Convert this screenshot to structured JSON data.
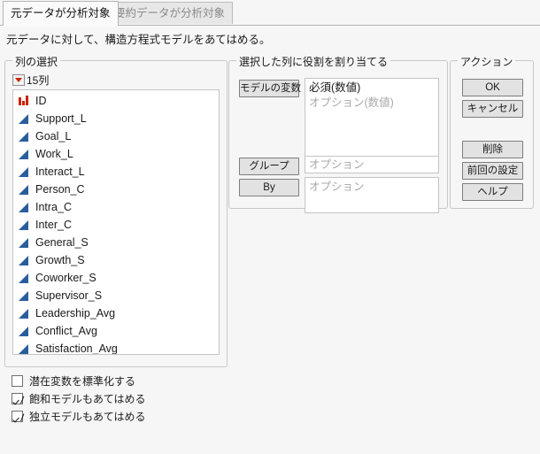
{
  "tabs": [
    {
      "label": "元データが分析対象",
      "active": true
    },
    {
      "label": "要約データが分析対象",
      "active": false
    }
  ],
  "description": "元データに対して、構造方程式モデルをあてはめる。",
  "columns_panel": {
    "title": "列の選択",
    "count_label": "15列",
    "dropdown_icon": "red-triangle-icon",
    "items": [
      {
        "label": "ID",
        "icon": "nominal-bars-icon"
      },
      {
        "label": "Support_L",
        "icon": "continuous-triangle-icon"
      },
      {
        "label": "Goal_L",
        "icon": "continuous-triangle-icon"
      },
      {
        "label": "Work_L",
        "icon": "continuous-triangle-icon"
      },
      {
        "label": "Interact_L",
        "icon": "continuous-triangle-icon"
      },
      {
        "label": "Person_C",
        "icon": "continuous-triangle-icon"
      },
      {
        "label": "Intra_C",
        "icon": "continuous-triangle-icon"
      },
      {
        "label": "Inter_C",
        "icon": "continuous-triangle-icon"
      },
      {
        "label": "General_S",
        "icon": "continuous-triangle-icon"
      },
      {
        "label": "Growth_S",
        "icon": "continuous-triangle-icon"
      },
      {
        "label": "Coworker_S",
        "icon": "continuous-triangle-icon"
      },
      {
        "label": "Supervisor_S",
        "icon": "continuous-triangle-icon"
      },
      {
        "label": "Leadership_Avg",
        "icon": "continuous-triangle-icon"
      },
      {
        "label": "Conflict_Avg",
        "icon": "continuous-triangle-icon"
      },
      {
        "label": "Satisfaction_Avg",
        "icon": "continuous-triangle-icon"
      }
    ]
  },
  "roles_panel": {
    "title": "選択した列に役割を割り当てる",
    "model_button": "モデルの変数",
    "model_required": "必須(数値)",
    "model_optional": "オプション(数値)",
    "group_button": "グループ",
    "group_placeholder": "オプション",
    "by_button": "By",
    "by_placeholder": "オプション"
  },
  "actions_panel": {
    "title": "アクション",
    "ok": "OK",
    "cancel": "キャンセル",
    "remove": "削除",
    "recall": "前回の設定",
    "help": "ヘルプ"
  },
  "options": [
    {
      "label": "潜在変数を標準化する",
      "checked": false
    },
    {
      "label": "飽和モデルもあてはめる",
      "checked": true
    },
    {
      "label": "独立モデルもあてはめる",
      "checked": true
    }
  ],
  "colors": {
    "nominal_icon": "#cc2200",
    "continuous_icon": "#2a5d9c",
    "window_bg": "#f6f6f6",
    "field_bg": "#ffffff",
    "button_bg": "#e2e2e2",
    "placeholder_text": "#a9a9a9"
  }
}
